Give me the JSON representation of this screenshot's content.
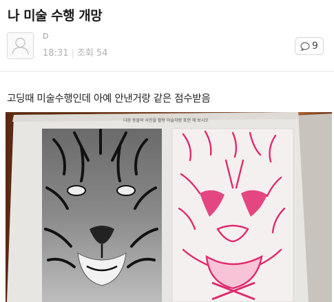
{
  "post": {
    "title": "나 미술 수행 개망",
    "author": "D",
    "time": "18:31",
    "views": "조회 54",
    "comment_count": "9",
    "body": "고딩때 미술수행인데 아예 안낸거랑 같은 점수받음"
  },
  "photo": {
    "worksheet_instruction": "다음 동물의 사진을 활용 미술처럼 표현 해 보시오"
  },
  "colors": {
    "pen": "#e0286e",
    "background": "#ffffff",
    "meta_text": "#b0b0b0"
  }
}
